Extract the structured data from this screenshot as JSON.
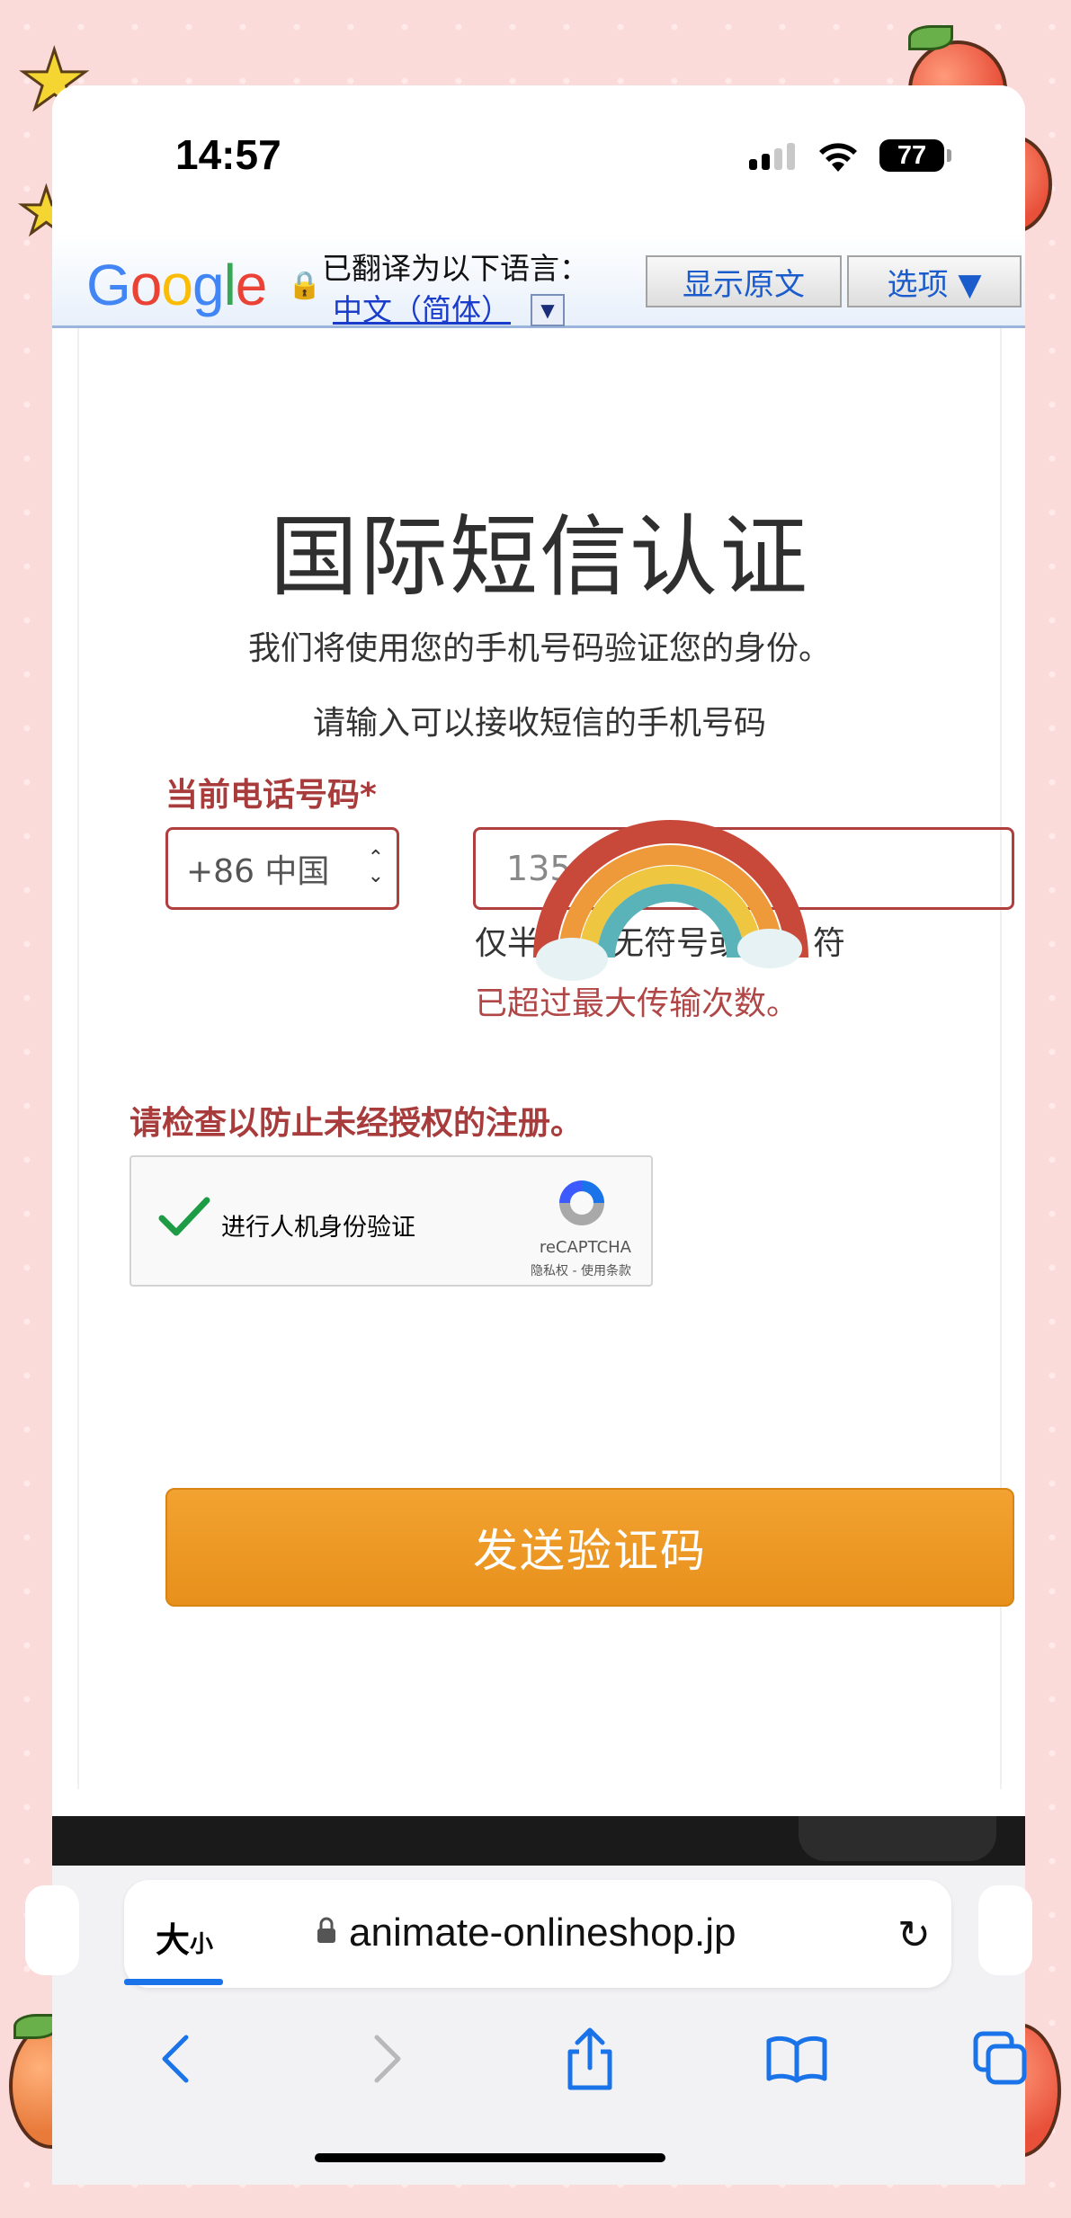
{
  "status_bar": {
    "time": "14:57",
    "battery": "77"
  },
  "translate_bar": {
    "logo": "Google",
    "translated_to_label": "已翻译为以下语言：",
    "language": "中文（简体）",
    "dropdown_glyph": "▼",
    "show_original_button": "显示原文",
    "options_button": "选项 ▼"
  },
  "page": {
    "title": "国际短信认证",
    "subtitle_1": "我们将使用您的手机号码验证您的身份。",
    "subtitle_2": "请输入可以接收短信的手机号码",
    "phone_label": "当前电话号码*",
    "country_code": "+86 中国",
    "phone_value": "135",
    "hint": "仅半",
    "hint_tail": "无符号或",
    "hint_end": "符",
    "error_max": "已超过最大传输次数。",
    "check_warning": "请检查以防止未经授权的注册。",
    "recaptcha": {
      "label": "进行人机身份验证",
      "brand": "reCAPTCHA",
      "terms": "隐私权 - 使用条款"
    },
    "send_button": "发送验证码"
  },
  "browser": {
    "text_size_big": "大",
    "text_size_small": "小",
    "url": "animate-onlineshop.jp",
    "reload_glyph": "↻"
  },
  "colors": {
    "accent_red": "#a83c3c",
    "button_orange": "#ee9a25",
    "link_blue": "#1a3ccb",
    "safari_blue": "#1a73e8"
  }
}
